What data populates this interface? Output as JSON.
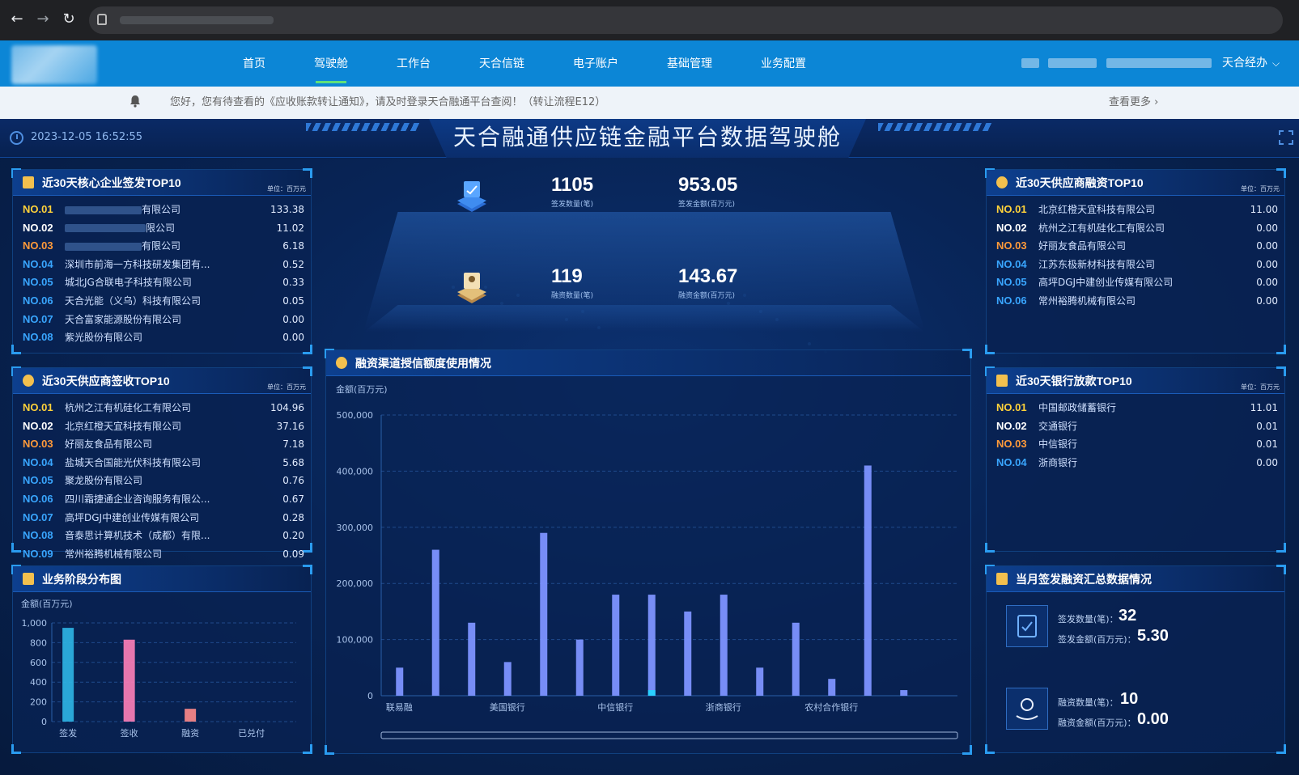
{
  "nav": {
    "items": [
      {
        "label": "首页"
      },
      {
        "label": "驾驶舱"
      },
      {
        "label": "工作台"
      },
      {
        "label": "天合信链"
      },
      {
        "label": "电子账户"
      },
      {
        "label": "基础管理"
      },
      {
        "label": "业务配置"
      }
    ],
    "active_index": 1,
    "user": "天合经办"
  },
  "notice": {
    "text": "您好，您有待查看的《应收账款转让通知》，请及时登录天合融通平台查阅！（转让流程E12）",
    "more": "查看更多",
    "icons": {
      "bell": "bell-icon",
      "more": "chevron-right-icon"
    }
  },
  "header": {
    "datetime": "2023-12-05 16:52:55",
    "title": "天合融通供应链金融平台数据驾驶舱"
  },
  "colors": {
    "accent": "#2a9cf0",
    "rank1": "#ffd23a",
    "rank3": "#ff9a3a",
    "rank_default": "#39a6ff",
    "bar": "#6f86ff"
  },
  "core_issue": {
    "title": "近30天核心企业签发TOP10",
    "unit": "单位：百万元",
    "rows": [
      {
        "no": "NO.01",
        "name": "有限公司",
        "value": "133.38",
        "redacted": true
      },
      {
        "no": "NO.02",
        "name": "限公司",
        "value": "11.02",
        "redacted": true
      },
      {
        "no": "NO.03",
        "name": "有限公司",
        "value": "6.18",
        "redacted": true
      },
      {
        "no": "NO.04",
        "name": "深圳市前海一方科技研发集团有...",
        "value": "0.52"
      },
      {
        "no": "NO.05",
        "name": "城北JG合联电子科技有限公司",
        "value": "0.33"
      },
      {
        "no": "NO.06",
        "name": "天合光能（义乌）科技有限公司",
        "value": "0.05"
      },
      {
        "no": "NO.07",
        "name": "天合富家能源股份有限公司",
        "value": "0.00"
      },
      {
        "no": "NO.08",
        "name": "紫光股份有限公司",
        "value": "0.00"
      }
    ]
  },
  "supplier_receive": {
    "title": "近30天供应商签收TOP10",
    "unit": "单位：百万元",
    "rows": [
      {
        "no": "NO.01",
        "name": "杭州之江有机硅化工有限公司",
        "value": "104.96"
      },
      {
        "no": "NO.02",
        "name": "北京红橙天宜科技有限公司",
        "value": "37.16"
      },
      {
        "no": "NO.03",
        "name": "好丽友食品有限公司",
        "value": "7.18"
      },
      {
        "no": "NO.04",
        "name": "盐城天合国能光伏科技有限公司",
        "value": "5.68"
      },
      {
        "no": "NO.05",
        "name": "聚龙股份有限公司",
        "value": "0.76"
      },
      {
        "no": "NO.06",
        "name": "四川霜捷通企业咨询服务有限公...",
        "value": "0.67"
      },
      {
        "no": "NO.07",
        "name": "高坪DGJ中建创业传媒有限公司",
        "value": "0.28"
      },
      {
        "no": "NO.08",
        "name": "音泰思计算机技术（成都）有限...",
        "value": "0.20"
      },
      {
        "no": "NO.09",
        "name": "常州裕腾机械有限公司",
        "value": "0.09"
      }
    ]
  },
  "supplier_finance": {
    "title": "近30天供应商融资TOP10",
    "unit": "单位：百万元",
    "rows": [
      {
        "no": "NO.01",
        "name": "北京红橙天宜科技有限公司",
        "value": "11.00"
      },
      {
        "no": "NO.02",
        "name": "杭州之江有机硅化工有限公司",
        "value": "0.00"
      },
      {
        "no": "NO.03",
        "name": "好丽友食品有限公司",
        "value": "0.00"
      },
      {
        "no": "NO.04",
        "name": "江苏东极新材科技有限公司",
        "value": "0.00"
      },
      {
        "no": "NO.05",
        "name": "高坪DGJ中建创业传媒有限公司",
        "value": "0.00"
      },
      {
        "no": "NO.06",
        "name": "常州裕腾机械有限公司",
        "value": "0.00"
      }
    ]
  },
  "bank_loan": {
    "title": "近30天银行放款TOP10",
    "unit": "单位：百万元",
    "rows": [
      {
        "no": "NO.01",
        "name": "中国邮政储蓄银行",
        "value": "11.01"
      },
      {
        "no": "NO.02",
        "name": "交通银行",
        "value": "0.01"
      },
      {
        "no": "NO.03",
        "name": "中信银行",
        "value": "0.01"
      },
      {
        "no": "NO.04",
        "name": "浙商银行",
        "value": "0.00"
      }
    ]
  },
  "stats": {
    "issue_count": "1105",
    "issue_count_label": "签发数量(笔)",
    "issue_amount": "953.05",
    "issue_amount_label": "签发金额(百万元)",
    "finance_count": "119",
    "finance_count_label": "融资数量(笔)",
    "finance_amount": "143.67",
    "finance_amount_label": "融资金额(百万元)"
  },
  "monthly": {
    "title": "当月签发融资汇总数据情况",
    "issue_count_label": "签发数量(笔)：",
    "issue_count": "32",
    "issue_amount_label": "签发金额(百万元)：",
    "issue_amount": "5.30",
    "finance_count_label": "融资数量(笔)：",
    "finance_count": "10",
    "finance_amount_label": "融资金额(百万元)：",
    "finance_amount": "0.00"
  },
  "chart_data": [
    {
      "type": "bar",
      "title": "业务阶段分布图",
      "ylabel": "金额(百万元)",
      "categories": [
        "签发",
        "签收",
        "融资",
        "已兑付"
      ],
      "values": [
        950,
        830,
        130,
        0
      ],
      "ylim": [
        0,
        1000
      ],
      "yticks": [
        "0",
        "200",
        "400",
        "600",
        "800",
        "1,000"
      ],
      "grid": true,
      "colors": [
        "#2fb6e6",
        "#ff7fb8",
        "#ff8a8a",
        "#8aa0ff"
      ]
    },
    {
      "type": "bar",
      "title": "融资渠道授信额度使用情况",
      "ylabel": "金额(百万元)",
      "categories": [
        "联易融",
        "",
        "",
        "美国银行",
        "",
        "",
        "中信银行",
        "",
        "",
        "浙商银行",
        "",
        "",
        "农村合作银行",
        "",
        "",
        ""
      ],
      "series": [
        {
          "values": [
            50000,
            260000,
            130000,
            60000,
            290000,
            100000,
            180000,
            180000,
            150000,
            180000,
            50000,
            130000,
            30000,
            410000,
            10000,
            0
          ]
        },
        {
          "values": [
            0,
            0,
            0,
            0,
            0,
            0,
            0,
            10000,
            0,
            0,
            0,
            0,
            0,
            0,
            0,
            0
          ]
        }
      ],
      "ylim": [
        0,
        500000
      ],
      "yticks": [
        "0",
        "100,000",
        "200,000",
        "300,000",
        "400,000",
        "500,000"
      ],
      "grid": true
    }
  ]
}
